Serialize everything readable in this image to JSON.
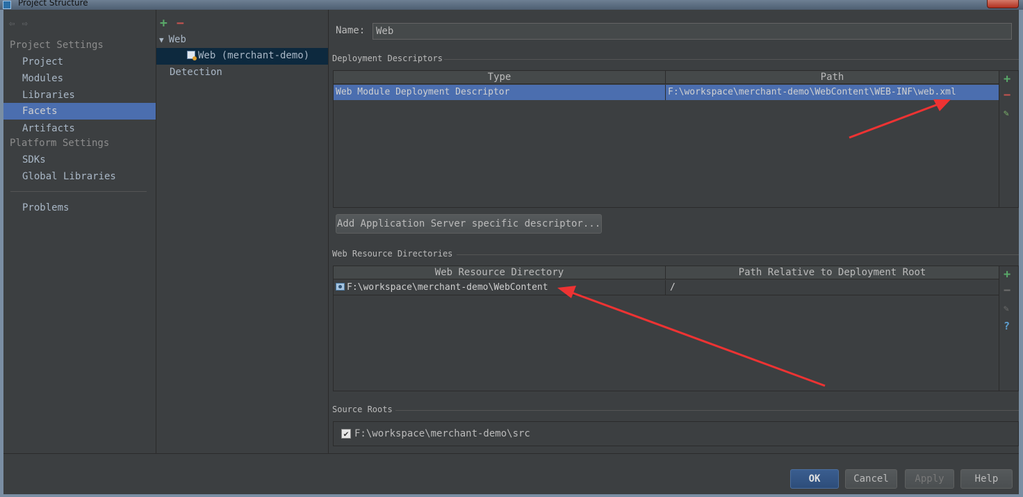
{
  "window": {
    "title": "Project Structure"
  },
  "nav": {
    "back_icon": "arrow-left-icon",
    "forward_icon": "arrow-right-icon",
    "project_settings_label": "Project Settings",
    "project_items": [
      "Project",
      "Modules",
      "Libraries",
      "Facets",
      "Artifacts"
    ],
    "platform_settings_label": "Platform Settings",
    "platform_items": [
      "SDKs",
      "Global Libraries"
    ],
    "problems_label": "Problems",
    "selected": "Facets"
  },
  "tree": {
    "add_icon": "+",
    "remove_icon": "−",
    "root_label": "Web",
    "child_label": "Web (merchant-demo)",
    "detection_label": "Detection"
  },
  "facet": {
    "name_label": "Name:",
    "name_value": "Web",
    "deployment_descriptors": {
      "title": "Deployment Descriptors",
      "columns": [
        "Type",
        "Path"
      ],
      "rows": [
        {
          "type": "Web Module Deployment Descriptor",
          "path": "F:\\workspace\\merchant-demo\\WebContent\\WEB-INF\\web.xml"
        }
      ]
    },
    "add_server_descriptor_label": "Add Application Server specific descriptor...",
    "web_resource_directories": {
      "title": "Web Resource Directories",
      "columns": [
        "Web Resource Directory",
        "Path Relative to Deployment Root"
      ],
      "rows": [
        {
          "directory": "F:\\workspace\\merchant-demo\\WebContent",
          "relative_path": "/"
        }
      ]
    },
    "source_roots": {
      "title": "Source Roots",
      "items": [
        {
          "checked": true,
          "path": "F:\\workspace\\merchant-demo\\src"
        }
      ]
    }
  },
  "tool_glyphs": {
    "add": "+",
    "remove": "−",
    "edit": "✎",
    "help": "?"
  },
  "buttons": {
    "ok": "OK",
    "cancel": "Cancel",
    "apply": "Apply",
    "help": "Help"
  },
  "colors": {
    "selection": "#4b6eaf",
    "background": "#3c3f41",
    "annotation_arrow": "#ee3333"
  }
}
